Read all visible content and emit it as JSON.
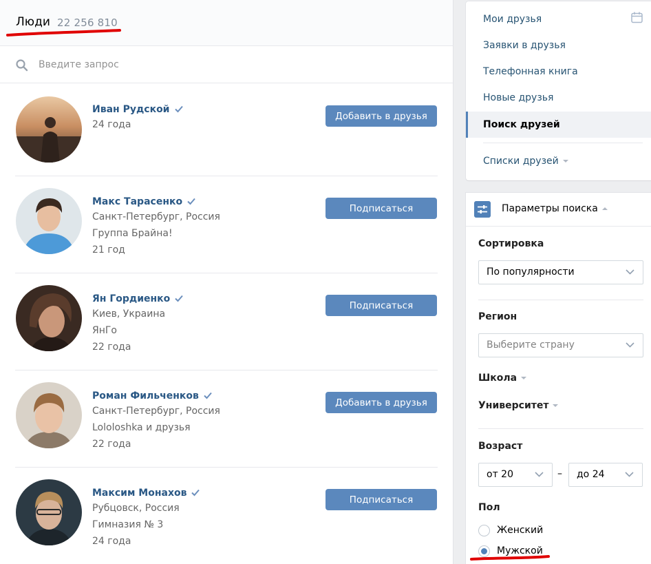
{
  "header": {
    "title": "Люди",
    "count": "22 256 810"
  },
  "search": {
    "placeholder": "Введите запрос"
  },
  "people": [
    {
      "name": "Иван Рудской",
      "lines": [
        "24 года"
      ],
      "action": "Добавить в друзья"
    },
    {
      "name": "Макс Тарасенко",
      "lines": [
        "Санкт-Петербург, Россия",
        "Группа Брайна!",
        "21 год"
      ],
      "action": "Подписаться"
    },
    {
      "name": "Ян Гордиенко",
      "lines": [
        "Киев, Украина",
        "ЯнГо",
        "22 года"
      ],
      "action": "Подписаться"
    },
    {
      "name": "Роман Фильченков",
      "lines": [
        "Санкт-Петербург, Россия",
        "Lololoshka и друзья",
        "22 года"
      ],
      "action": "Добавить в друзья"
    },
    {
      "name": "Максим Монахов",
      "lines": [
        "Рубцовск, Россия",
        "Гимназия № 3",
        "24 года"
      ],
      "action": "Подписаться"
    }
  ],
  "nav": {
    "items": [
      "Мои друзья",
      "Заявки в друзья",
      "Телефонная книга",
      "Новые друзья",
      "Поиск друзей"
    ],
    "active": "Поиск друзей",
    "lists": "Списки друзей"
  },
  "params": {
    "title": "Параметры поиска",
    "sort_label": "Сортировка",
    "sort_value": "По популярности",
    "region_label": "Регион",
    "region_placeholder": "Выберите страну",
    "school_label": "Школа",
    "university_label": "Университет",
    "age_label": "Возраст",
    "age_from": "от 20",
    "age_dash": "–",
    "age_to": "до 24",
    "sex_label": "Пол",
    "sex_options": [
      "Женский",
      "Мужской"
    ],
    "sex_selected": "Мужской"
  },
  "colors": {
    "accent": "#5181b8",
    "button": "#5b88bd",
    "link": "#2a5885",
    "annotation": "#e00000"
  },
  "icons": [
    "search-icon",
    "verified-icon",
    "calendar-icon",
    "filter-icon",
    "chevron-down-icon",
    "caret-down-icon",
    "caret-up-icon"
  ]
}
